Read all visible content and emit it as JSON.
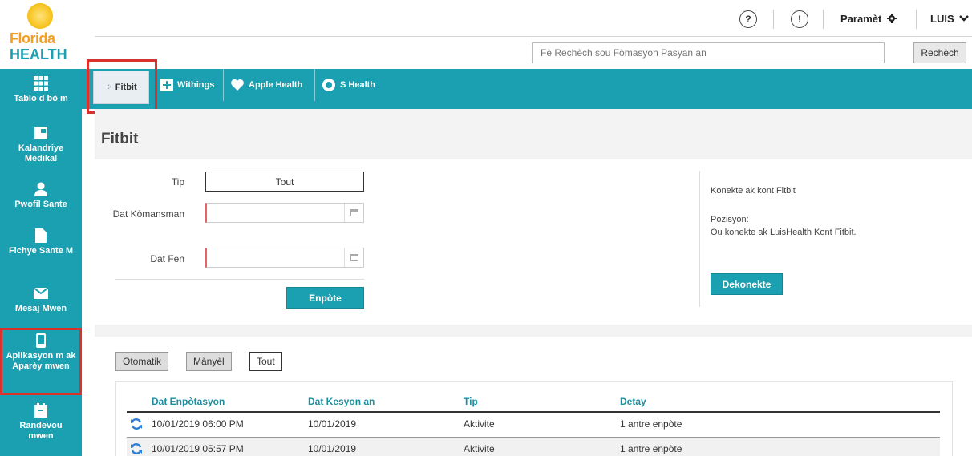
{
  "logo": {
    "line1": "Florida",
    "line2": "HEALTH"
  },
  "top_bar": {
    "help_label": "?",
    "alert_label": "!",
    "settings_label": "Paramèt",
    "user_label": "LUIS"
  },
  "search": {
    "placeholder": "Fè Rechèch sou Fòmasyon Pasyan an",
    "button": "Rechèch"
  },
  "sidebar": {
    "items": [
      {
        "label": "Tablo d bò m"
      },
      {
        "label": "Kalandriye Medikal"
      },
      {
        "label": "Pwofil Sante"
      },
      {
        "label": "Fichye Sante M"
      },
      {
        "label": "Mesaj Mwen"
      },
      {
        "label": "Aplikasyon m ak Aparèy mwen"
      },
      {
        "label": "Randevou mwen"
      }
    ]
  },
  "tabs": [
    {
      "label": "Fitbit"
    },
    {
      "label": "Withings"
    },
    {
      "label": "Apple Health"
    },
    {
      "label": "S Health"
    }
  ],
  "page": {
    "title": "Fitbit"
  },
  "form": {
    "type_label": "Tip",
    "type_value": "Tout",
    "start_label": "Dat Kòmansman",
    "end_label": "Dat Fen",
    "save_button": "Enpòte"
  },
  "account": {
    "connect_text": "Konekte ak kont Fitbit",
    "position_label": "Pozisyon:",
    "status_text": "Ou konekte ak LuisHealth Kont Fitbit.",
    "disconnect_button": "Dekonekte"
  },
  "filters": [
    {
      "label": "Otomatik"
    },
    {
      "label": "Mànyèl"
    },
    {
      "label": "Tout"
    }
  ],
  "table": {
    "headers": [
      "Dat Enpòtasyon",
      "Dat Kesyon an",
      "Tip",
      "Detay"
    ],
    "rows": [
      [
        "10/01/2019 06:00 PM",
        "10/01/2019",
        "Aktivite",
        "1 antre enpòte"
      ],
      [
        "10/01/2019 05:57 PM",
        "10/01/2019",
        "Aktivite",
        "1 antre enpòte"
      ]
    ]
  },
  "colors": {
    "accent": "#1aa0b0",
    "highlight": "#d9312b"
  }
}
